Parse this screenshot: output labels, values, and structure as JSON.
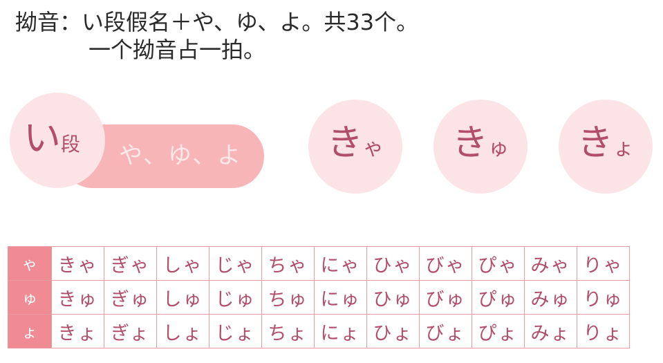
{
  "heading": {
    "line1": "拗音：い段假名＋や、ゆ、よ。共33个。",
    "line2": "一个拗音占一拍。"
  },
  "diagram": {
    "circle_kana": "い",
    "circle_kanji": "段",
    "pill_text": "や、ゆ、よ"
  },
  "bubbles": [
    {
      "big": "き",
      "small": "ゃ"
    },
    {
      "big": "き",
      "small": "ゅ"
    },
    {
      "big": "き",
      "small": "ょ"
    }
  ],
  "table": {
    "rows": [
      {
        "header": "ゃ",
        "cells": [
          "きゃ",
          "ぎゃ",
          "しゃ",
          "じゃ",
          "ちゃ",
          "にゃ",
          "ひゃ",
          "びゃ",
          "ぴゃ",
          "みゃ",
          "りゃ"
        ]
      },
      {
        "header": "ゅ",
        "cells": [
          "きゅ",
          "ぎゅ",
          "しゅ",
          "じゅ",
          "ちゅ",
          "にゅ",
          "ひゅ",
          "びゅ",
          "ぴゅ",
          "みゅ",
          "りゅ"
        ]
      },
      {
        "header": "ょ",
        "cells": [
          "きょ",
          "ぎょ",
          "しょ",
          "じょ",
          "ちょ",
          "にょ",
          "ひょ",
          "びょ",
          "ぴょ",
          "みょ",
          "りょ"
        ]
      }
    ]
  },
  "colors": {
    "accent": "#b24d6a",
    "pill": "#f7b5b8",
    "circle": "#fce4e6",
    "table_header": "#f08b93",
    "table_border": "#e79aa2"
  }
}
